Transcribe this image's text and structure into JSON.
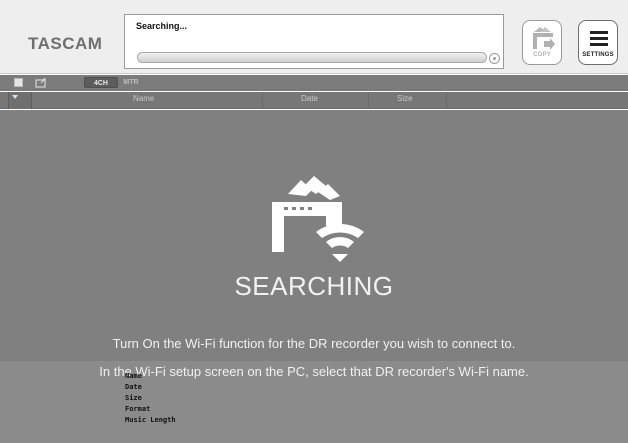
{
  "header": {
    "brand": "TASCAM",
    "status_text": "Searching...",
    "progress_fraction": 1.0,
    "copy_label": "COPY",
    "settings_label": "SETTINGS"
  },
  "toolbar": {
    "tabs": [
      {
        "label": "4CH",
        "selected": true
      },
      {
        "label": "MTR",
        "selected": false
      }
    ]
  },
  "columns": [
    "Name",
    "Date",
    "Size"
  ],
  "overlay": {
    "title": "SEARCHING",
    "message1": "Turn On the Wi-Fi function for the DR recorder you wish to connect to.",
    "message2": "In the Wi-Fi setup screen on the PC, select that DR recorder's Wi-Fi name."
  },
  "detail_fields": [
    "Name",
    "Date",
    "Size",
    "Format",
    "Music Length"
  ],
  "colors": {
    "header_bg": "#eeeeee",
    "list_bg": "#808080",
    "overlay_text": "#f2f2f2"
  },
  "icons": [
    "cancel-icon",
    "copy-icon",
    "menu-icon",
    "folder-icon",
    "recorder-icon",
    "wifi-icon"
  ]
}
